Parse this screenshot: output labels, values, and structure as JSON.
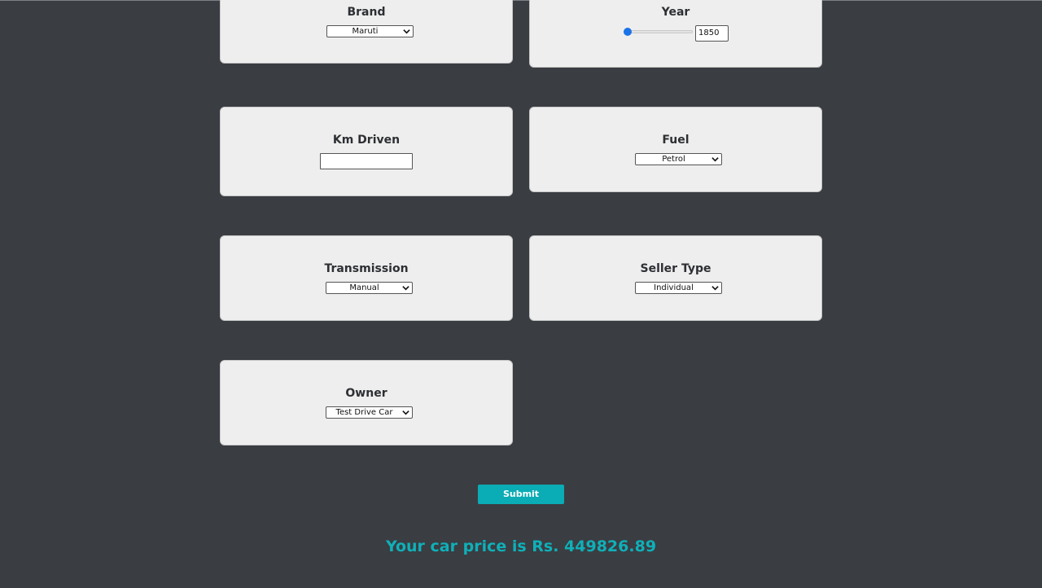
{
  "form": {
    "brand": {
      "label": "Brand",
      "value": "Maruti"
    },
    "year": {
      "label": "Year",
      "value": "1850",
      "slider_fraction": 0.0
    },
    "km_driven": {
      "label": "Km Driven",
      "value": ""
    },
    "fuel": {
      "label": "Fuel",
      "value": "Petrol"
    },
    "transmission": {
      "label": "Transmission",
      "value": "Manual"
    },
    "seller_type": {
      "label": "Seller Type",
      "value": "Individual"
    },
    "owner": {
      "label": "Owner",
      "value": "Test Drive Car"
    },
    "submit_label": "Submit"
  },
  "result": {
    "text": "Your car price is Rs. 449826.89"
  },
  "colors": {
    "background": "#3a3d42",
    "card": "#eeeeee",
    "accent": "#0aacb5",
    "slider_thumb": "#1a73e8"
  },
  "icons": {
    "select_arrow": "chevron-down-icon"
  }
}
